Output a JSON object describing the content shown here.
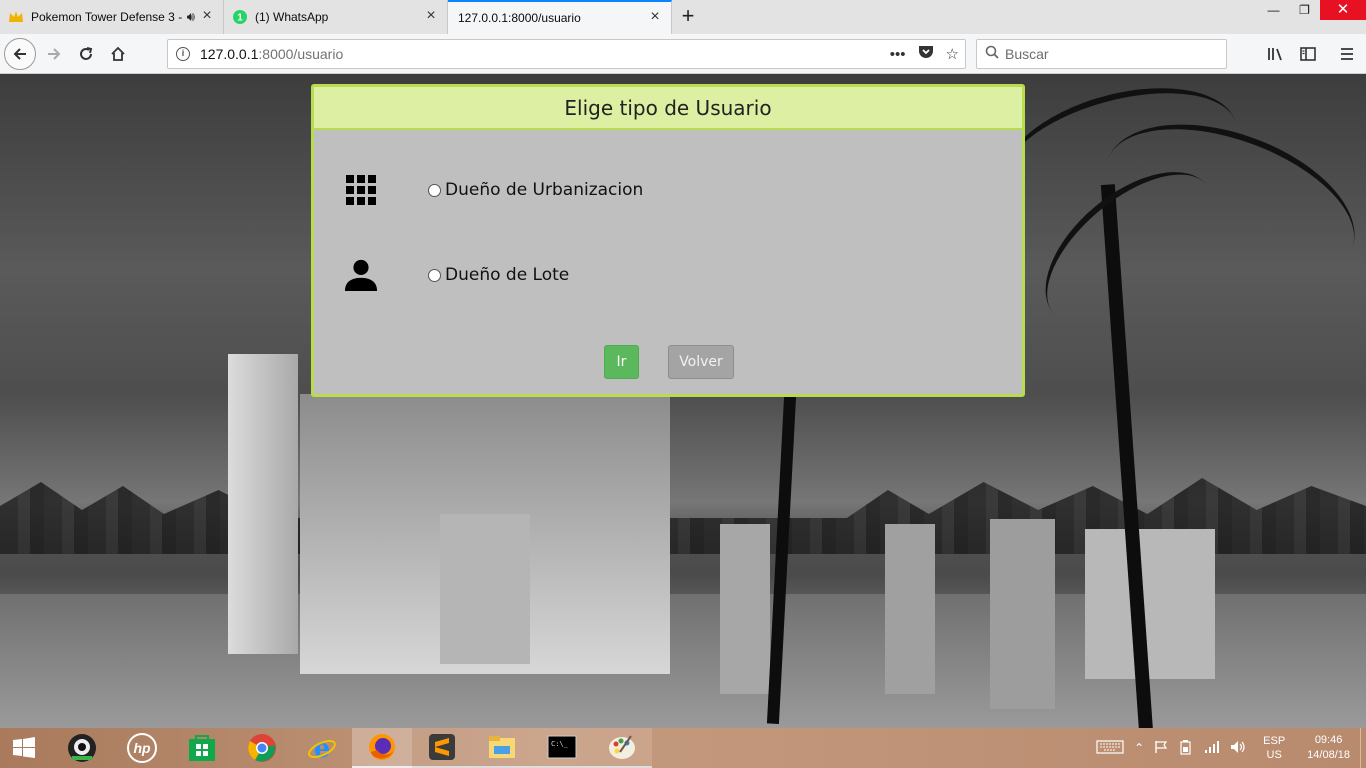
{
  "browser": {
    "tabs": [
      {
        "title": "Pokemon Tower Defense 3 -",
        "icon": "crown-icon",
        "audio": true
      },
      {
        "title": "(1) WhatsApp",
        "icon": "whatsapp-icon",
        "badge": "1"
      },
      {
        "title": "127.0.0.1:8000/usuario",
        "active": true
      }
    ],
    "url": {
      "host": "127.0.0.1",
      "rest": ":8000/usuario"
    },
    "search_placeholder": "Buscar",
    "accent": "#0a84ff"
  },
  "modal": {
    "title": "Elige tipo de Usuario",
    "options": [
      {
        "label": "Dueño de Urbanizacion",
        "icon": "grid-icon",
        "selected": false
      },
      {
        "label": "Dueño de Lote",
        "icon": "person-icon",
        "selected": false
      }
    ],
    "buttons": {
      "ir": "Ir",
      "volver": "Volver"
    },
    "colors": {
      "border": "#b7dd4e",
      "header_bg": "#dcefa2",
      "ir_bg": "#5cb85c",
      "volver_bg": "#a4a4a4"
    }
  },
  "taskbar": {
    "apps": [
      "windows-start-icon",
      "webcam-icon",
      "hp-icon",
      "store-icon",
      "chrome-icon",
      "ie-icon",
      "firefox-icon",
      "sublime-icon",
      "explorer-icon",
      "cmd-icon",
      "paint-icon"
    ],
    "lang": {
      "top": "ESP",
      "bottom": "US"
    },
    "clock": {
      "time": "09:46",
      "date": "14/08/18"
    }
  }
}
